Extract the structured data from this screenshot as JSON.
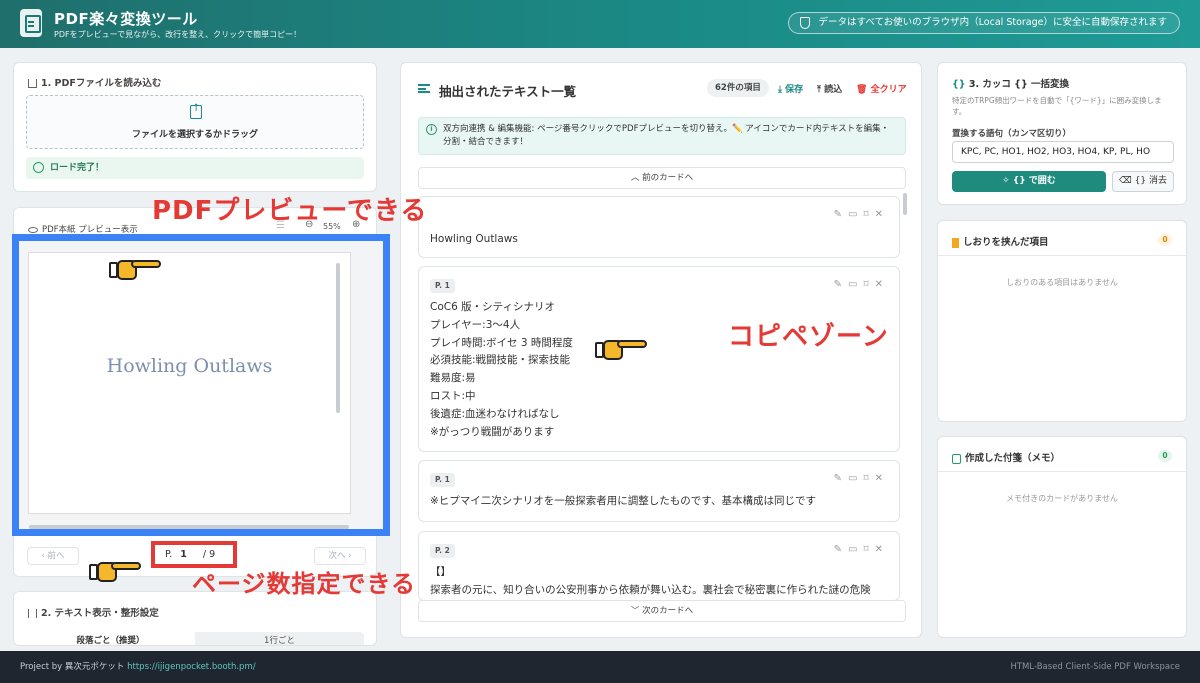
{
  "header": {
    "title": "PDF楽々変換ツール",
    "subtitle": "PDFをプレビューで見ながら、改行を整え、クリックで簡単コピー！",
    "storage_notice": "データはすべてお使いのブラウザ内（Local Storage）に安全に自動保存されます"
  },
  "load_section": {
    "title": "1. PDFファイルを読み込む",
    "drop_label": "ファイルを選択するかドラッグ",
    "status": "ロード完了！"
  },
  "preview": {
    "title": "PDF本紙 プレビュー表示",
    "zoom": "55%",
    "page_text": "Howling Outlaws",
    "prev_label": "前へ",
    "next_label": "次へ",
    "page_prefix": "P.",
    "page_current": "1",
    "page_total": "/ 9"
  },
  "text_settings": {
    "title": "2. テキスト表示・整形設定",
    "tabs": [
      "段落ごと（推奨）",
      "1行ごと"
    ]
  },
  "extracted": {
    "title": "抽出されたテキスト一覧",
    "count": "62件の項目",
    "save_label": "保存",
    "load_label": "読込",
    "clear_label": "全クリア",
    "info_text": "双方向連携 & 編集機能: ページ番号クリックでPDFプレビューを切り替え。✏️ アイコンでカード内テキストを編集・分割・結合できます！",
    "prev_cards": "前のカードへ",
    "next_cards": "次のカードへ",
    "cards": [
      {
        "page": "",
        "lines": [
          "Howling Outlaws"
        ]
      },
      {
        "page": "P. 1",
        "lines": [
          "CoC6 版・シティシナリオ",
          "プレイヤー:3〜4人",
          "プレイ時間:ボイセ 3 時間程度",
          "必須技能:戦闘技能・探索技能",
          "難易度:易",
          "ロスト:中",
          "後遺症:血迷わなければなし",
          "※がっつり戦闘があります"
        ]
      },
      {
        "page": "P. 1",
        "lines": [
          "※ヒプマイ二次シナリオを一般探索者用に調整したものです、基本構成は同じです"
        ]
      },
      {
        "page": "P. 2",
        "lines": [
          "【】",
          "探索者の元に、知り合いの公安刑事から依頼が舞い込む。裏社会で秘密裏に作られた謎の危険"
        ]
      }
    ]
  },
  "bracket": {
    "title": "3. カッコ {} 一括変換",
    "description": "特定のTRPG頻出ワードを自動で「{ワード}」に囲み変換します。",
    "words_label": "置換する語句（カンマ区切り）",
    "words_value": "KPC, PC, HO1, HO2, HO3, HO4, KP, PL, HO",
    "wrap_label": "{} で囲む",
    "erase_label": "{} 消去"
  },
  "bookmarks": {
    "title": "しおりを挟んだ項目",
    "count": "0",
    "empty": "しおりのある項目はありません"
  },
  "memos": {
    "title": "作成した付箋（メモ）",
    "count": "0",
    "empty": "メモ付きのカードがありません"
  },
  "annotations": {
    "preview_note": "PDFプレビューできる",
    "copy_note": "コピペゾーン",
    "page_note": "ページ数指定できる"
  },
  "footer": {
    "credit_prefix": "Project by 異次元ポケット",
    "credit_link": "https://ijigenpocket.booth.pm/",
    "tagline": "HTML-Based Client-Side PDF Workspace"
  },
  "colors": {
    "accent": "#1b8a86",
    "annotation_red": "#e53935",
    "highlight_blue": "#3b82f6",
    "danger": "#e53935"
  }
}
